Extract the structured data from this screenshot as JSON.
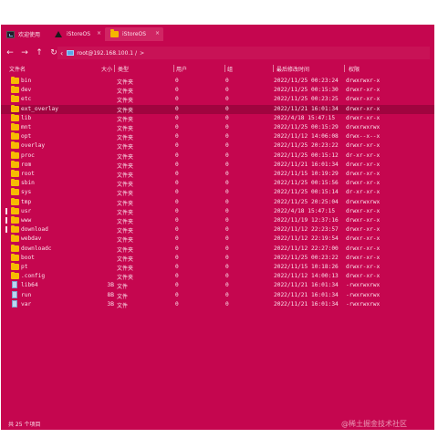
{
  "tabs": [
    {
      "label": "欢迎使用",
      "icon": "terminal-icon"
    },
    {
      "label": "iStoreOS",
      "icon": "triangle-logo-icon"
    },
    {
      "label": "iStoreOS",
      "icon": "folder-icon"
    }
  ],
  "toolbar": {
    "path": "root@192.168.100.1 /",
    "path_sep": ">"
  },
  "columns": {
    "name": "文件名",
    "size": "大小",
    "type": "类型",
    "user": "用户",
    "group": "组",
    "mtime": "最后修改时间",
    "perm": "权限"
  },
  "files": [
    {
      "name": "bin",
      "size": "",
      "type": "文件夹",
      "user": "0",
      "group": "0",
      "mtime": "2022/11/25 00:23:24",
      "perm": "drwxrwxr-x",
      "kind": "folder"
    },
    {
      "name": "dev",
      "size": "",
      "type": "文件夹",
      "user": "0",
      "group": "0",
      "mtime": "2022/11/25 00:15:30",
      "perm": "drwxr-xr-x",
      "kind": "folder"
    },
    {
      "name": "etc",
      "size": "",
      "type": "文件夹",
      "user": "0",
      "group": "0",
      "mtime": "2022/11/25 00:23:25",
      "perm": "drwxr-xr-x",
      "kind": "folder"
    },
    {
      "name": "ext_overlay",
      "size": "",
      "type": "文件夹",
      "user": "0",
      "group": "0",
      "mtime": "2022/11/21 16:01:34",
      "perm": "drwxr-xr-x",
      "kind": "folder"
    },
    {
      "name": "lib",
      "size": "",
      "type": "文件夹",
      "user": "0",
      "group": "0",
      "mtime": "2022/4/18 15:47:15",
      "perm": "drwxr-xr-x",
      "kind": "folder"
    },
    {
      "name": "mnt",
      "size": "",
      "type": "文件夹",
      "user": "0",
      "group": "0",
      "mtime": "2022/11/25 00:15:29",
      "perm": "drwxrwxrwx",
      "kind": "folder"
    },
    {
      "name": "opt",
      "size": "",
      "type": "文件夹",
      "user": "0",
      "group": "0",
      "mtime": "2022/11/12 14:06:08",
      "perm": "drwx--x--x",
      "kind": "folder"
    },
    {
      "name": "overlay",
      "size": "",
      "type": "文件夹",
      "user": "0",
      "group": "0",
      "mtime": "2022/11/25 20:23:22",
      "perm": "drwxr-xr-x",
      "kind": "folder"
    },
    {
      "name": "proc",
      "size": "",
      "type": "文件夹",
      "user": "0",
      "group": "0",
      "mtime": "2022/11/25 00:15:12",
      "perm": "dr-xr-xr-x",
      "kind": "folder"
    },
    {
      "name": "rom",
      "size": "",
      "type": "文件夹",
      "user": "0",
      "group": "0",
      "mtime": "2022/11/21 16:01:34",
      "perm": "drwxr-xr-x",
      "kind": "folder"
    },
    {
      "name": "root",
      "size": "",
      "type": "文件夹",
      "user": "0",
      "group": "0",
      "mtime": "2022/11/15 10:19:29",
      "perm": "drwxr-xr-x",
      "kind": "folder"
    },
    {
      "name": "sbin",
      "size": "",
      "type": "文件夹",
      "user": "0",
      "group": "0",
      "mtime": "2022/11/25 00:15:56",
      "perm": "drwxr-xr-x",
      "kind": "folder"
    },
    {
      "name": "sys",
      "size": "",
      "type": "文件夹",
      "user": "0",
      "group": "0",
      "mtime": "2022/11/25 00:15:14",
      "perm": "dr-xr-xr-x",
      "kind": "folder"
    },
    {
      "name": "tmp",
      "size": "",
      "type": "文件夹",
      "user": "0",
      "group": "0",
      "mtime": "2022/11/25 20:25:04",
      "perm": "drwxrwxrwx",
      "kind": "folder"
    },
    {
      "name": "usr",
      "size": "",
      "type": "文件夹",
      "user": "0",
      "group": "0",
      "mtime": "2022/4/18 15:47:15",
      "perm": "drwxr-xr-x",
      "kind": "folder"
    },
    {
      "name": "www",
      "size": "",
      "type": "文件夹",
      "user": "0",
      "group": "0",
      "mtime": "2022/11/19 12:37:16",
      "perm": "drwxr-xr-x",
      "kind": "folder"
    },
    {
      "name": "download",
      "size": "",
      "type": "文件夹",
      "user": "0",
      "group": "0",
      "mtime": "2022/11/12 22:23:57",
      "perm": "drwxr-xr-x",
      "kind": "folder"
    },
    {
      "name": "webdav",
      "size": "",
      "type": "文件夹",
      "user": "0",
      "group": "0",
      "mtime": "2022/11/12 22:19:54",
      "perm": "drwxr-xr-x",
      "kind": "folder"
    },
    {
      "name": "downloadc",
      "size": "",
      "type": "文件夹",
      "user": "0",
      "group": "0",
      "mtime": "2022/11/12 22:27:00",
      "perm": "drwxr-xr-x",
      "kind": "folder"
    },
    {
      "name": "boot",
      "size": "",
      "type": "文件夹",
      "user": "0",
      "group": "0",
      "mtime": "2022/11/25 00:23:22",
      "perm": "drwxr-xr-x",
      "kind": "folder"
    },
    {
      "name": "pt",
      "size": "",
      "type": "文件夹",
      "user": "0",
      "group": "0",
      "mtime": "2022/11/15 10:18:26",
      "perm": "drwxr-xr-x",
      "kind": "folder"
    },
    {
      "name": ".config",
      "size": "",
      "type": "文件夹",
      "user": "0",
      "group": "0",
      "mtime": "2022/11/12 14:00:13",
      "perm": "drwxr-xr-x",
      "kind": "folder"
    },
    {
      "name": "lib64",
      "size": "3B",
      "type": "文件",
      "user": "0",
      "group": "0",
      "mtime": "2022/11/21 16:01:34",
      "perm": "-rwxrwxrwx",
      "kind": "file"
    },
    {
      "name": "run",
      "size": "8B",
      "type": "文件",
      "user": "0",
      "group": "0",
      "mtime": "2022/11/21 16:01:34",
      "perm": "-rwxrwxrwx",
      "kind": "file"
    },
    {
      "name": "var",
      "size": "3B",
      "type": "文件",
      "user": "0",
      "group": "0",
      "mtime": "2022/11/21 16:01:34",
      "perm": "-rwxrwxrwx",
      "kind": "file"
    }
  ],
  "status": {
    "count": "共 25 个项目",
    "watermark": "@稀土掘金技术社区"
  },
  "colors": {
    "background": "#c5064f",
    "selected_row": "#a0043f",
    "folder": "#f7bb00",
    "text": "#fbe3ec"
  }
}
